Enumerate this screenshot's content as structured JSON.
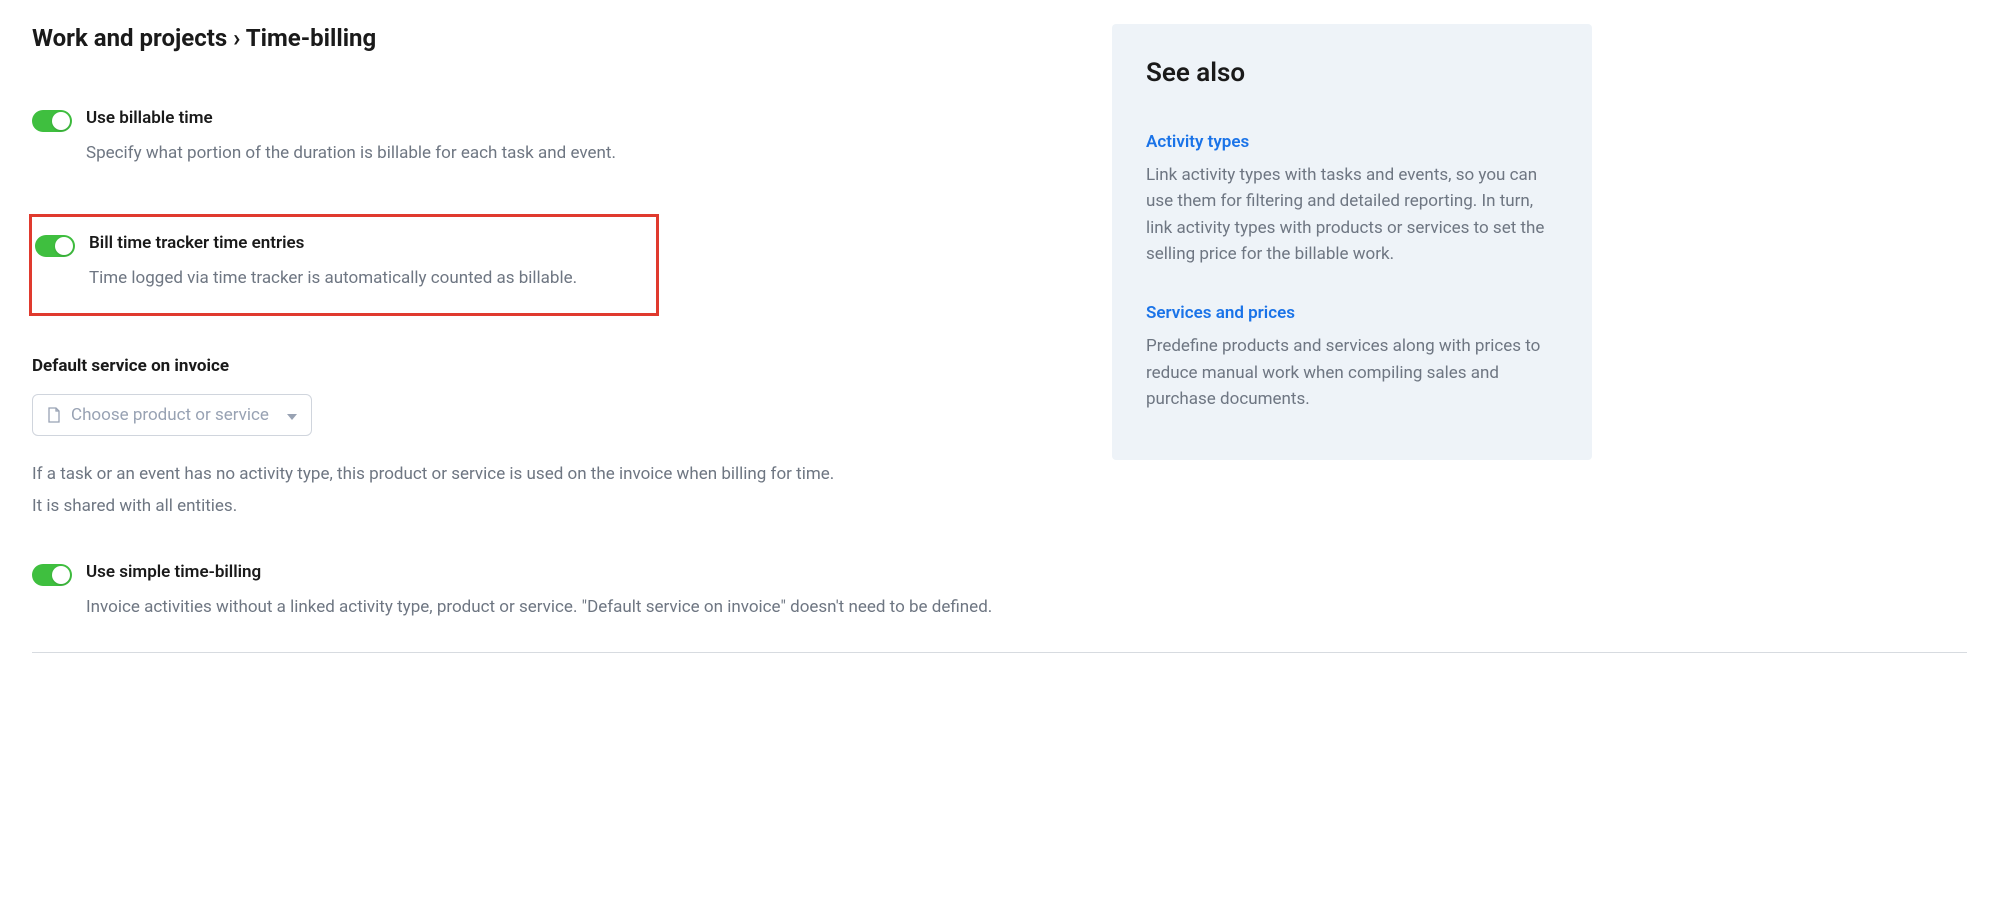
{
  "breadcrumb": "Work and projects › Time-billing",
  "settings": {
    "billable_time": {
      "title": "Use billable time",
      "desc": "Specify what portion of the duration is billable for each task and event."
    },
    "bill_time_tracker": {
      "title": "Bill time tracker time entries",
      "desc": "Time logged via time tracker is automatically counted as billable."
    },
    "default_service": {
      "label": "Default service on invoice",
      "placeholder": "Choose product or service",
      "hint_line1": "If a task or an event has no activity type, this product or service is used on the invoice when billing for time.",
      "hint_line2": "It is shared with all entities."
    },
    "simple_billing": {
      "title": "Use simple time-billing",
      "desc": "Invoice activities without a linked activity type, product or service. \"Default service on invoice\" doesn't need to be defined."
    }
  },
  "sidebar": {
    "title": "See also",
    "items": [
      {
        "link": "Activity types",
        "desc": "Link activity types with tasks and events, so you can use them for filtering and detailed reporting. In turn, link activity types with products or services to set the selling price for the billable work."
      },
      {
        "link": "Services and prices",
        "desc": "Predefine products and services along with prices to reduce manual work when compiling sales and purchase documents."
      }
    ]
  }
}
